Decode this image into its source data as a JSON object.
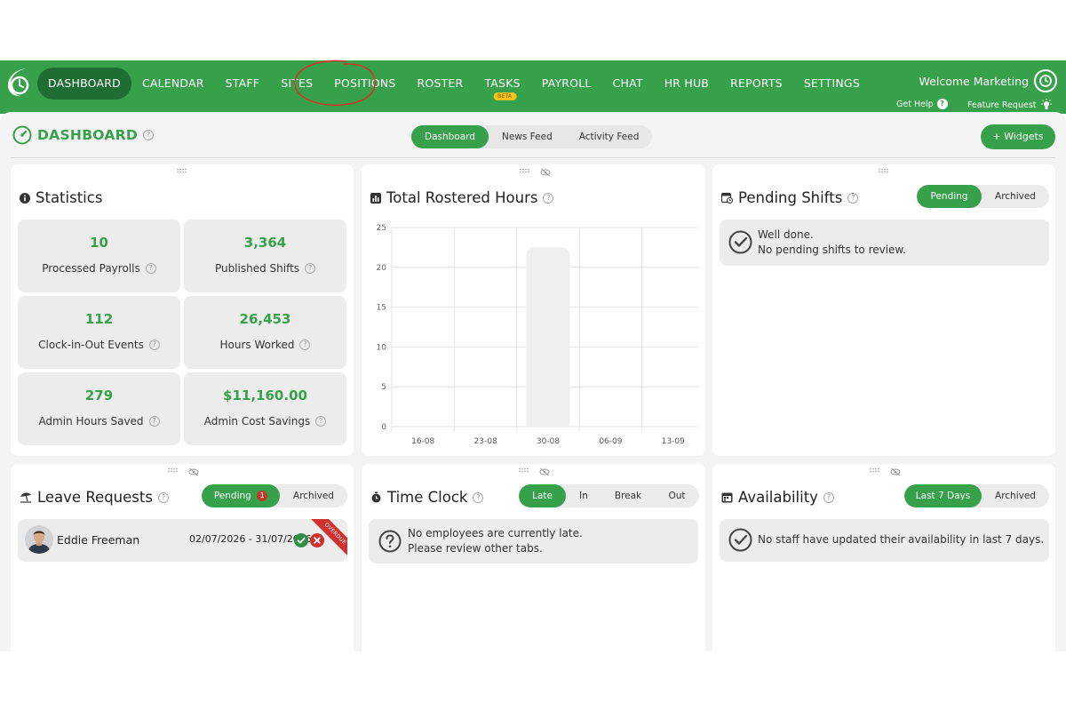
{
  "nav": {
    "items": [
      {
        "label": "DASHBOARD",
        "active": true
      },
      {
        "label": "CALENDAR"
      },
      {
        "label": "STAFF"
      },
      {
        "label": "SITES"
      },
      {
        "label": "POSITIONS"
      },
      {
        "label": "ROSTER"
      },
      {
        "label": "TASKS",
        "badge": "BETA"
      },
      {
        "label": "PAYROLL"
      },
      {
        "label": "CHAT"
      },
      {
        "label": "HR HUB"
      },
      {
        "label": "REPORTS"
      },
      {
        "label": "SETTINGS"
      }
    ],
    "welcome": "Welcome Marketing",
    "get_help": "Get Help",
    "feature_request": "Feature Request",
    "accent_color": "#36a04a",
    "annotation_color": "#d9312a"
  },
  "page": {
    "title": "DASHBOARD",
    "tabs": [
      "Dashboard",
      "News Feed",
      "Activity Feed"
    ],
    "add_widgets": "+ Widgets"
  },
  "statistics": {
    "title": "Statistics",
    "items": [
      {
        "value": "10",
        "label": "Processed Payrolls"
      },
      {
        "value": "3,364",
        "label": "Published Shifts"
      },
      {
        "value": "112",
        "label": "Clock-in-Out Events"
      },
      {
        "value": "26,453",
        "label": "Hours Worked"
      },
      {
        "value": "279",
        "label": "Admin Hours Saved"
      },
      {
        "value": "$11,160.00",
        "label": "Admin Cost Savings"
      }
    ]
  },
  "rostered_hours": {
    "title": "Total Rostered Hours"
  },
  "chart_data": {
    "type": "bar",
    "title": "Total Rostered Hours",
    "categories": [
      "16-08",
      "23-08",
      "30-08",
      "06-09",
      "13-09"
    ],
    "values": [
      0,
      0,
      22.5,
      0,
      0
    ],
    "y_ticks": [
      "0",
      "5",
      "10",
      "15",
      "20",
      "25"
    ],
    "ylim": [
      0,
      25
    ],
    "grid": true,
    "bar_color": "#efefef"
  },
  "pending_shifts": {
    "title": "Pending Shifts",
    "tabs": [
      "Pending",
      "Archived"
    ],
    "message_line1": "Well done.",
    "message_line2": "No pending shifts to review."
  },
  "leave_requests": {
    "title": "Leave Requests",
    "tabs": [
      "Pending",
      "Archived"
    ],
    "pending_count": "1",
    "rows": [
      {
        "name": "Eddie Freeman",
        "dates": "02/07/2026 - 31/07/2026",
        "ribbon": "OVERDUE"
      }
    ]
  },
  "time_clock": {
    "title": "Time Clock",
    "tabs": [
      "Late",
      "In",
      "Break",
      "Out"
    ],
    "message_line1": "No employees are currently late.",
    "message_line2": "Please review other tabs."
  },
  "availability": {
    "title": "Availability",
    "tabs": [
      "Last 7 Days",
      "Archived"
    ],
    "message": "No staff have updated their availability in last 7 days."
  }
}
